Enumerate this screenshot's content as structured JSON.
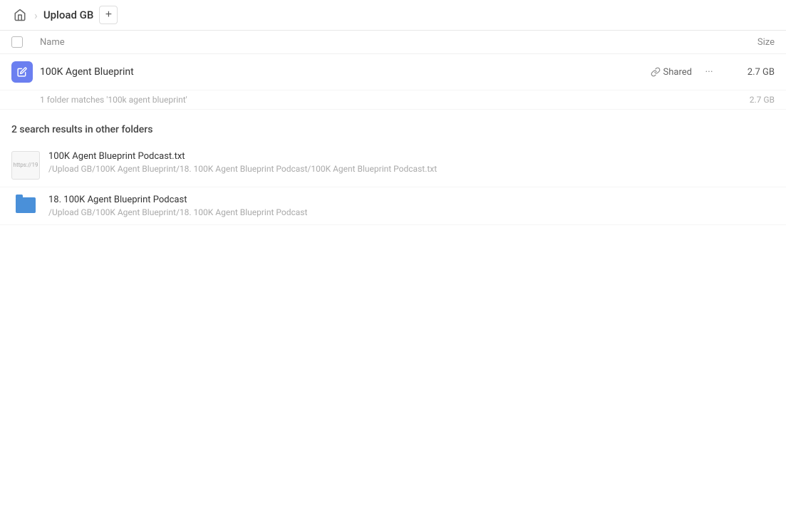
{
  "header": {
    "home_icon": "🏠",
    "breadcrumb_title": "Upload GB",
    "add_button_label": "+"
  },
  "table": {
    "col_name": "Name",
    "col_size": "Size"
  },
  "main_result": {
    "name": "100K Agent Blueprint",
    "shared_label": "Shared",
    "more_icon": "···",
    "size": "2.7 GB"
  },
  "match_note": {
    "text": "1 folder matches '100k agent blueprint'",
    "size": "2.7 GB"
  },
  "other_section": {
    "title": "2 search results in other folders"
  },
  "other_results": [
    {
      "name": "100K Agent Blueprint Podcast.txt",
      "path": "/Upload GB/100K Agent Blueprint/18. 100K Agent Blueprint Podcast/100K Agent Blueprint Podcast.txt",
      "thumb_text": "https://19"
    },
    {
      "name": "18. 100K Agent Blueprint Podcast",
      "path": "/Upload GB/100K Agent Blueprint/18. 100K Agent Blueprint Podcast",
      "is_folder": true
    }
  ]
}
